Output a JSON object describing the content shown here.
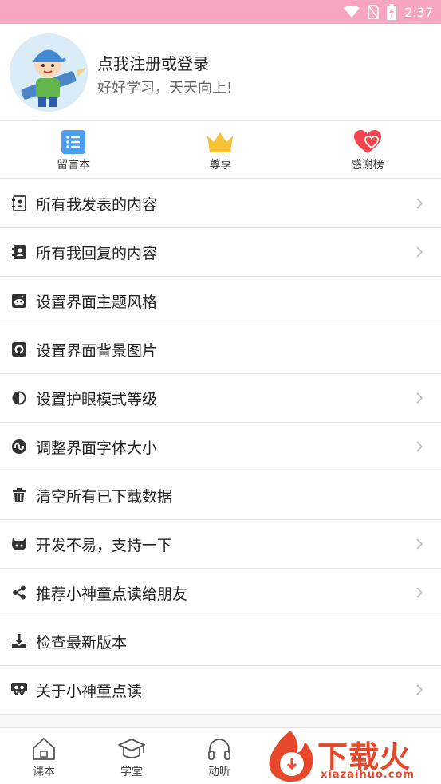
{
  "status_bar": {
    "time": "2:37",
    "icons": [
      "wifi-icon",
      "no-sim-icon",
      "battery-charging-icon"
    ]
  },
  "profile": {
    "name": "点我注册或登录",
    "motto": "好好学习，天天向上!"
  },
  "quick_actions": [
    {
      "label": "留言本",
      "icon": "list-icon",
      "color": "#4a9df0"
    },
    {
      "label": "尊享",
      "icon": "crown-icon",
      "color": "#f6c234"
    },
    {
      "label": "感谢榜",
      "icon": "hearts-icon",
      "color": "#f2454f"
    }
  ],
  "menu": [
    {
      "label": "所有我发表的内容",
      "icon": "contact-book-icon",
      "chevron": true
    },
    {
      "label": "所有我回复的内容",
      "icon": "contact-book-filled-icon",
      "chevron": true
    },
    {
      "label": "设置界面主题风格",
      "icon": "reddit-icon",
      "chevron": false
    },
    {
      "label": "设置界面背景图片",
      "icon": "github-icon",
      "chevron": false
    },
    {
      "label": "设置护眼模式等级",
      "icon": "contrast-icon",
      "chevron": true
    },
    {
      "label": "调整界面字体大小",
      "icon": "stumbleupon-icon",
      "chevron": true
    },
    {
      "label": "清空所有已下载数据",
      "icon": "trash-icon",
      "chevron": false
    },
    {
      "label": "开发不易，支持一下",
      "icon": "github-alt-icon",
      "chevron": true
    },
    {
      "label": "推荐小神童点读给朋友",
      "icon": "share-icon",
      "chevron": true
    },
    {
      "label": "检查最新版本",
      "icon": "download-icon",
      "chevron": false
    },
    {
      "label": "关于小神童点读",
      "icon": "slideshare-icon",
      "chevron": true
    }
  ],
  "tabs": [
    {
      "label": "课本",
      "icon": "home-icon"
    },
    {
      "label": "学堂",
      "icon": "graduation-cap-icon"
    },
    {
      "label": "动听",
      "icon": "headphones-icon"
    }
  ],
  "watermark": {
    "title": "下载火",
    "subtitle": "xiazaihuo.com",
    "color": "#e8472a"
  }
}
